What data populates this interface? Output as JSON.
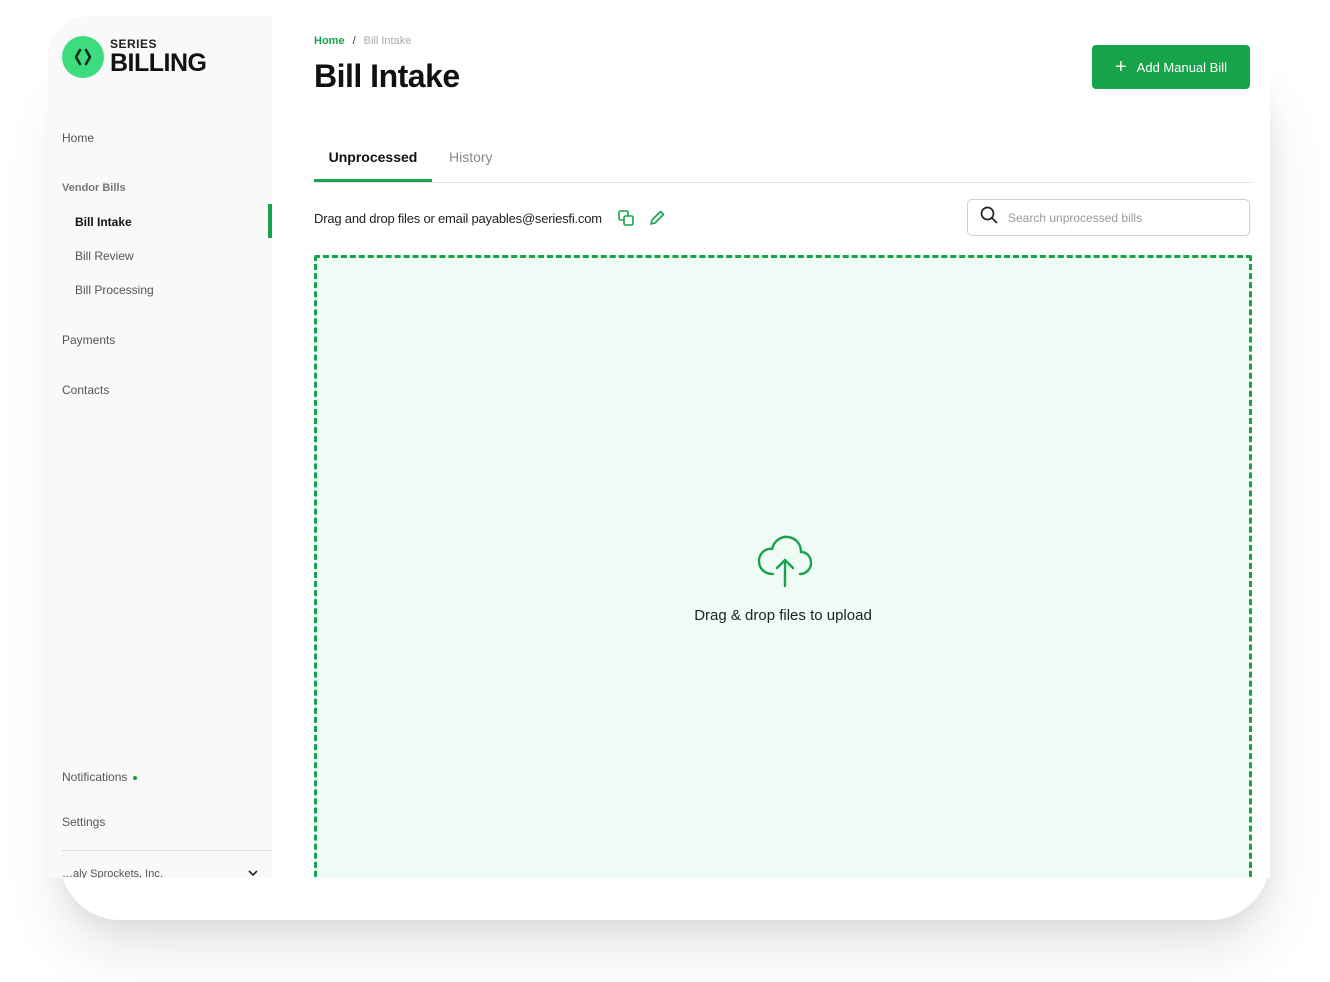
{
  "brand": {
    "top": "SERIES",
    "main": "BILLING"
  },
  "sidebar": {
    "home": "Home",
    "vendor_bills": "Vendor Bills",
    "sub_items": [
      "Bill Intake",
      "Bill Review",
      "Bill Processing"
    ],
    "payments": "Payments",
    "contacts": "Contacts",
    "notifications": "Notifications",
    "settings": "Settings",
    "org_name": "…aly Sprockets, Inc."
  },
  "breadcrumb": {
    "home": "Home",
    "separator": "/",
    "current": "Bill Intake"
  },
  "page_title": "Bill Intake",
  "actions": {
    "add_manual_bill": "Add Manual Bill"
  },
  "tabs": [
    {
      "label": "Unprocessed",
      "active": true
    },
    {
      "label": "History",
      "active": false
    }
  ],
  "intake": {
    "instructions": "Drag and drop files or email payables@seriesfi.com",
    "search_placeholder": "Search unprocessed bills",
    "dropzone_text": "Drag & drop files to upload"
  },
  "colors": {
    "accent": "#17a34a",
    "logo_badge": "#3ddc7e",
    "dropzone_bg": "#effcf5",
    "sidebar_bg": "#f9f9f9"
  },
  "icons": [
    "code-brackets-icon",
    "plus-icon",
    "copy-icon",
    "pencil-icon",
    "search-icon",
    "cloud-upload-icon",
    "chevron-down-icon"
  ]
}
